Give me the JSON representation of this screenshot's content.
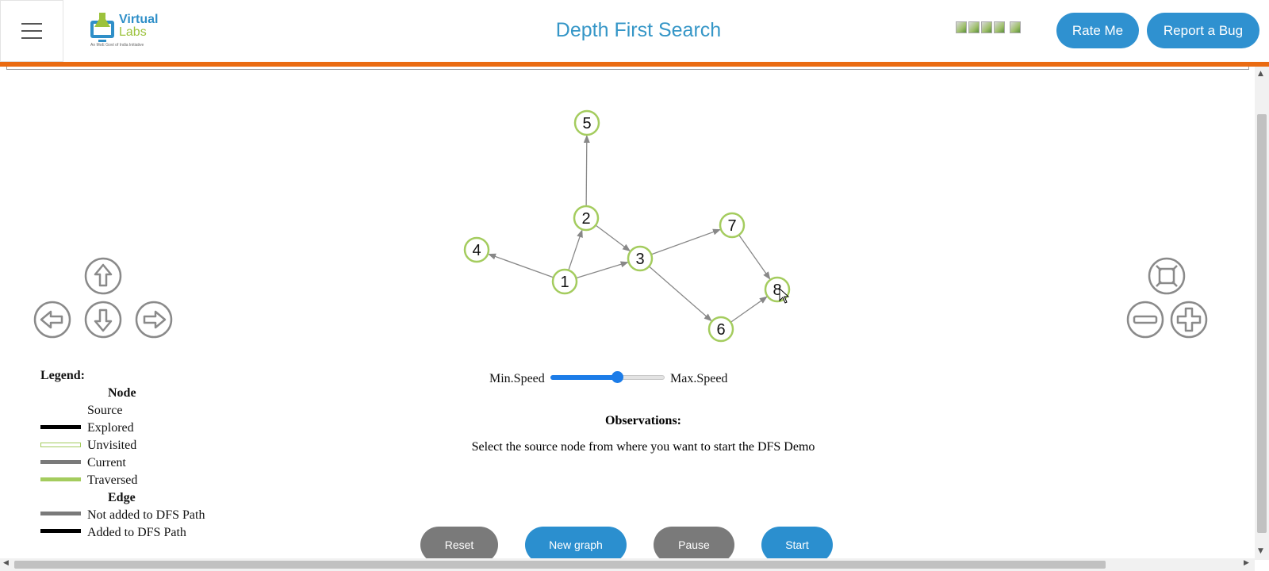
{
  "header": {
    "logo_line1": "Virtual",
    "logo_line2": "Labs",
    "logo_tagline": "An MoE Govt of India Initiative",
    "title": "Depth First Search",
    "rate_label": "Rate Me",
    "bug_label": "Report a Bug"
  },
  "graph": {
    "nodes": [
      {
        "id": "1",
        "label": "1"
      },
      {
        "id": "2",
        "label": "2"
      },
      {
        "id": "3",
        "label": "3"
      },
      {
        "id": "4",
        "label": "4"
      },
      {
        "id": "5",
        "label": "5"
      },
      {
        "id": "6",
        "label": "6"
      },
      {
        "id": "7",
        "label": "7"
      },
      {
        "id": "8",
        "label": "8"
      }
    ],
    "edges": [
      {
        "from": "1",
        "to": "4"
      },
      {
        "from": "1",
        "to": "2"
      },
      {
        "from": "1",
        "to": "3"
      },
      {
        "from": "2",
        "to": "5"
      },
      {
        "from": "2",
        "to": "3"
      },
      {
        "from": "3",
        "to": "7"
      },
      {
        "from": "3",
        "to": "6"
      },
      {
        "from": "7",
        "to": "8"
      },
      {
        "from": "6",
        "to": "8"
      }
    ],
    "node_state": "Unvisited",
    "colors": {
      "node_border": "#a4cc5e",
      "edge": "#888888"
    }
  },
  "speed": {
    "min_label": "Min.Speed",
    "max_label": "Max.Speed",
    "value_fraction": 0.58
  },
  "observations": {
    "title": "Observations:",
    "text": "Select the source node from where you want to start the DFS Demo"
  },
  "legend": {
    "title": "Legend:",
    "node_header": "Node",
    "source": "Source",
    "explored": "Explored",
    "unvisited": "Unvisited",
    "current": "Current",
    "traversed": "Traversed",
    "edge_header": "Edge",
    "not_added": "Not added to DFS Path",
    "added": "Added to DFS Path"
  },
  "buttons": {
    "reset": "Reset",
    "new_graph": "New graph",
    "pause": "Pause",
    "start": "Start"
  },
  "icons": [
    "menu-icon",
    "arrow-up-icon",
    "arrow-left-icon",
    "arrow-down-icon",
    "arrow-right-icon",
    "fit-screen-icon",
    "zoom-out-icon",
    "zoom-in-icon"
  ]
}
